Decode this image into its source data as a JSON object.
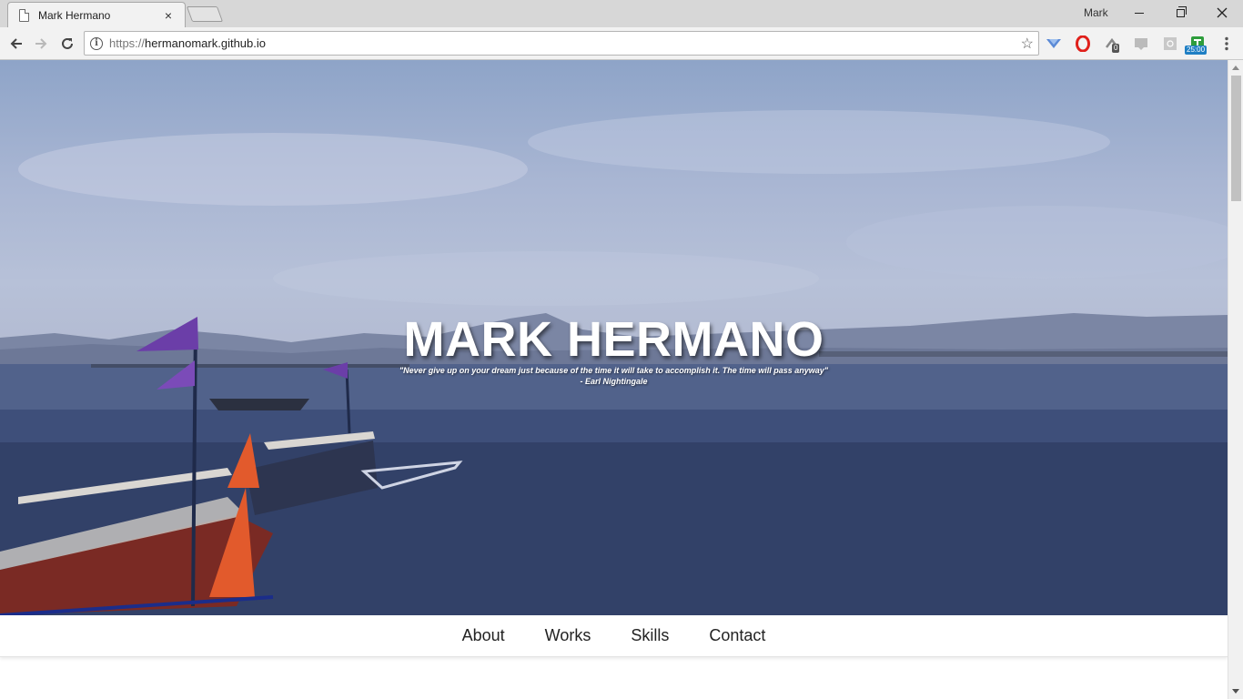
{
  "browser": {
    "tab_title": "Mark Hermano",
    "tab_close": "×",
    "user_name": "Mark",
    "url_scheme": "https://",
    "url_host": "hermanomark.github.io",
    "extension_badge_count": "0",
    "timer_badge": "25:00"
  },
  "hero": {
    "name": "MARK HERMANO",
    "quote": "\"Never give up on your dream just because of the time it will take to accomplish it. The time will pass anyway\"",
    "author": "- Earl Nightingale"
  },
  "nav": {
    "items": [
      {
        "label": "About"
      },
      {
        "label": "Works"
      },
      {
        "label": "Skills"
      },
      {
        "label": "Contact"
      }
    ]
  },
  "colors": {
    "chrome_bg": "#f2f2f2",
    "titlebar_bg": "#d7d7d7",
    "hero_text": "#ffffff",
    "nav_text": "#222222"
  }
}
